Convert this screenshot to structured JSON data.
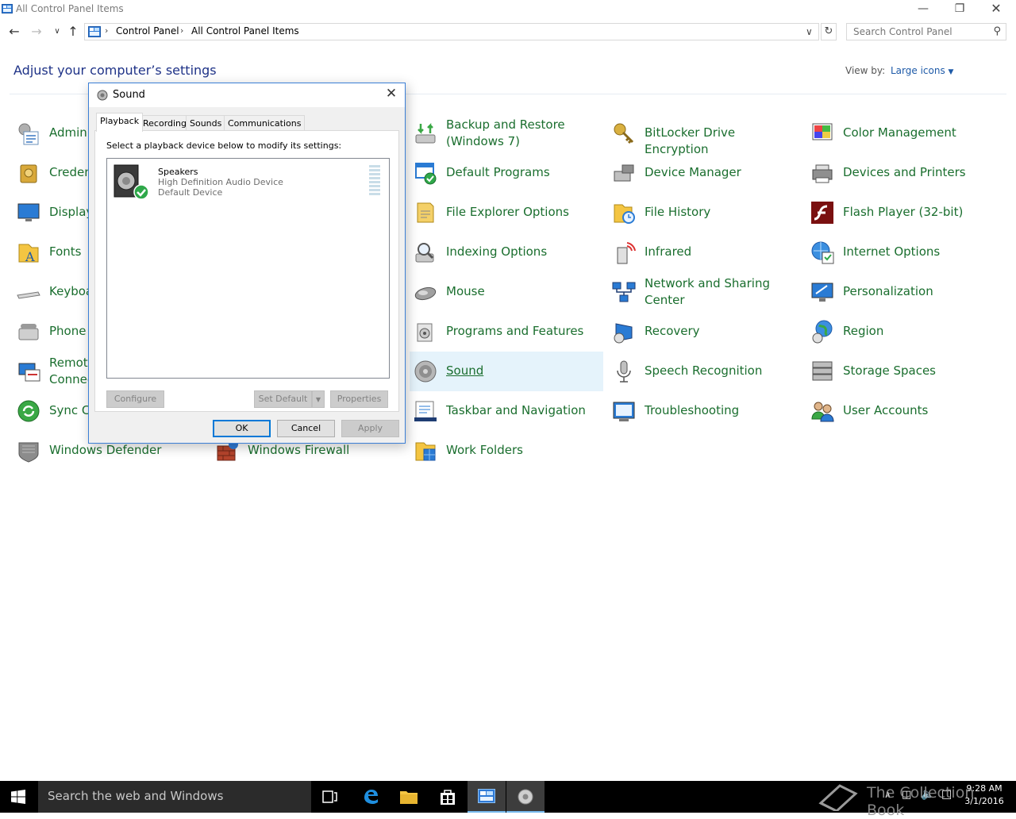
{
  "window": {
    "title": "All Control Panel Items"
  },
  "address": {
    "crumbs": [
      "Control Panel",
      "All Control Panel Items"
    ],
    "search_placeholder": "Search Control Panel"
  },
  "header": {
    "title": "Adjust your computer’s settings",
    "view_by_label": "View by:",
    "view_by_value": "Large icons"
  },
  "items": {
    "col1": [
      "Admini",
      "Creden",
      "Display",
      "Fonts",
      "Keyboa",
      "Phone",
      "Remote Connec",
      "Sync Ce",
      "Windows Defender"
    ],
    "col1_remote": [
      "Remote",
      "Connec"
    ],
    "col2": [
      "Windows Firewall"
    ],
    "col3": [
      "Backup and Restore (Windows 7)",
      "Default Programs",
      "File Explorer Options",
      "Indexing Options",
      "Mouse",
      "Programs and Features",
      "Sound",
      "Taskbar and Navigation",
      "Work Folders"
    ],
    "col3_backup": [
      "Backup and Restore",
      "(Windows 7)"
    ],
    "col4": [
      "BitLocker Drive Encryption",
      "Device Manager",
      "File History",
      "Infrared",
      "Network and Sharing Center",
      "Recovery",
      "Speech Recognition",
      "Troubleshooting"
    ],
    "col4_network": [
      "Network and Sharing",
      "Center"
    ],
    "col5": [
      "Color Management",
      "Devices and Printers",
      "Flash Player (32-bit)",
      "Internet Options",
      "Personalization",
      "Region",
      "Storage Spaces",
      "User Accounts"
    ]
  },
  "dialog": {
    "title": "Sound",
    "tabs": [
      "Playback",
      "Recording",
      "Sounds",
      "Communications"
    ],
    "hint": "Select a playback device below to modify its settings:",
    "device": {
      "name": "Speakers",
      "line1": "High Definition Audio Device",
      "line2": "Default Device"
    },
    "buttons": {
      "configure": "Configure",
      "set_default": "Set Default",
      "properties": "Properties",
      "ok": "OK",
      "cancel": "Cancel",
      "apply": "Apply"
    }
  },
  "taskbar": {
    "search_text": "Search the web and Windows",
    "time": "9:28 AM",
    "date": "3/1/2016"
  },
  "watermark": "The Collection Book",
  "colors": {
    "link_green": "#1a6e2e",
    "heading_blue": "#1e3287",
    "accent": "#0078d7"
  }
}
